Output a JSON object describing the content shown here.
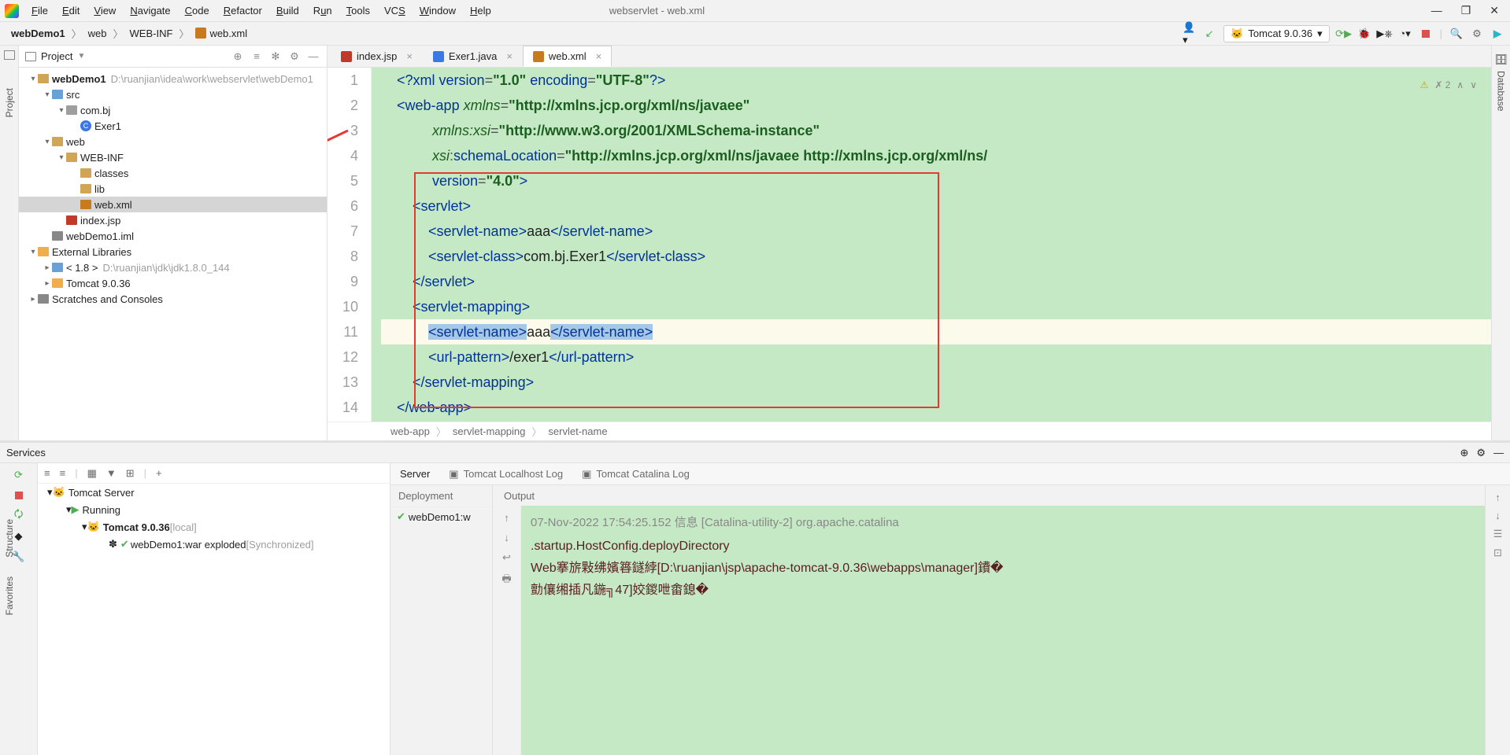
{
  "window": {
    "title": "webservlet - web.xml",
    "buttons": {
      "min": "—",
      "max": "❐",
      "close": "✕"
    }
  },
  "menu": [
    "File",
    "Edit",
    "View",
    "Navigate",
    "Code",
    "Refactor",
    "Build",
    "Run",
    "Tools",
    "VCS",
    "Window",
    "Help"
  ],
  "breadcrumbs": {
    "root": "webDemo1",
    "parts": [
      "web",
      "WEB-INF",
      "web.xml"
    ]
  },
  "runConfig": "Tomcat 9.0.36",
  "projectPanel": {
    "title": "Project",
    "tree": {
      "root": "webDemo1",
      "rootPath": "D:\\ruanjian\\idea\\work\\webservlet\\webDemo1",
      "src": "src",
      "pkg": "com.bj",
      "cls": "Exer1",
      "web": "web",
      "webinf": "WEB-INF",
      "classes": "classes",
      "lib": "lib",
      "webxml": "web.xml",
      "indexjsp": "index.jsp",
      "iml": "webDemo1.iml",
      "ext": "External Libraries",
      "jdk": "< 1.8 >",
      "jdkPath": "D:\\ruanjian\\jdk\\jdk1.8.0_144",
      "tomcat": "Tomcat 9.0.36",
      "scratches": "Scratches and Consoles"
    }
  },
  "leftTabs": {
    "project": "Project"
  },
  "rightTabs": {
    "database": "Database"
  },
  "bottomTabs": {
    "structure": "Structure",
    "favorites": "Favorites"
  },
  "editorTabs": [
    {
      "label": "index.jsp",
      "active": false,
      "color": "#c0392b"
    },
    {
      "label": "Exer1.java",
      "active": false,
      "color": "#3b78e7"
    },
    {
      "label": "web.xml",
      "active": true,
      "color": "#c77b1e"
    }
  ],
  "editorTopRight": "✗ 2",
  "codeLines": [
    {
      "n": 1,
      "seg": [
        {
          "t": "    ",
          "c": "pc"
        },
        {
          "t": "<?",
          "c": "tag"
        },
        {
          "t": "xml version",
          "c": "attr"
        },
        {
          "t": "=",
          "c": "pc"
        },
        {
          "t": "\"1.0\"",
          "c": "str"
        },
        {
          "t": " encoding",
          "c": "attr"
        },
        {
          "t": "=",
          "c": "pc"
        },
        {
          "t": "\"UTF-8\"",
          "c": "str"
        },
        {
          "t": "?>",
          "c": "tag"
        }
      ]
    },
    {
      "n": 2,
      "seg": [
        {
          "t": "    ",
          "c": "pc"
        },
        {
          "t": "<",
          "c": "tag"
        },
        {
          "t": "web-app ",
          "c": "tag"
        },
        {
          "t": "xmlns",
          "c": "attrn"
        },
        {
          "t": "=",
          "c": "pc"
        },
        {
          "t": "\"http://xmlns.jcp.org/xml/ns/javaee\"",
          "c": "str"
        }
      ]
    },
    {
      "n": 3,
      "seg": [
        {
          "t": "             ",
          "c": "pc"
        },
        {
          "t": "xmlns:xsi",
          "c": "attrn"
        },
        {
          "t": "=",
          "c": "pc"
        },
        {
          "t": "\"http://www.w3.org/2001/XMLSchema-instance\"",
          "c": "str"
        }
      ]
    },
    {
      "n": 4,
      "seg": [
        {
          "t": "             ",
          "c": "pc"
        },
        {
          "t": "xsi",
          "c": "attrn"
        },
        {
          "t": ":",
          "c": "pc"
        },
        {
          "t": "schemaLocation",
          "c": "attr"
        },
        {
          "t": "=",
          "c": "pc"
        },
        {
          "t": "\"http://xmlns.jcp.org/xml/ns/javaee http://xmlns.jcp.org/xml/ns/",
          "c": "str"
        }
      ]
    },
    {
      "n": 5,
      "seg": [
        {
          "t": "             ",
          "c": "pc"
        },
        {
          "t": "version",
          "c": "attr"
        },
        {
          "t": "=",
          "c": "pc"
        },
        {
          "t": "\"4.0\"",
          "c": "str"
        },
        {
          "t": ">",
          "c": "tag"
        }
      ]
    },
    {
      "n": 6,
      "seg": [
        {
          "t": "        ",
          "c": "pc"
        },
        {
          "t": "<",
          "c": "tag"
        },
        {
          "t": "servlet",
          "c": "tag"
        },
        {
          "t": ">",
          "c": "tag"
        }
      ]
    },
    {
      "n": 7,
      "seg": [
        {
          "t": "            ",
          "c": "pc"
        },
        {
          "t": "<",
          "c": "tag"
        },
        {
          "t": "servlet-name",
          "c": "tag"
        },
        {
          "t": ">",
          "c": "tag"
        },
        {
          "t": "aaa",
          "c": "txt"
        },
        {
          "t": "</",
          "c": "tag"
        },
        {
          "t": "servlet-name",
          "c": "tag"
        },
        {
          "t": ">",
          "c": "tag"
        }
      ]
    },
    {
      "n": 8,
      "seg": [
        {
          "t": "            ",
          "c": "pc"
        },
        {
          "t": "<",
          "c": "tag"
        },
        {
          "t": "servlet-class",
          "c": "tag"
        },
        {
          "t": ">",
          "c": "tag"
        },
        {
          "t": "com.bj.Exer1",
          "c": "txt"
        },
        {
          "t": "</",
          "c": "tag"
        },
        {
          "t": "servlet-class",
          "c": "tag"
        },
        {
          "t": ">",
          "c": "tag"
        }
      ]
    },
    {
      "n": 9,
      "seg": [
        {
          "t": "        ",
          "c": "pc"
        },
        {
          "t": "</",
          "c": "tag"
        },
        {
          "t": "servlet",
          "c": "tag"
        },
        {
          "t": ">",
          "c": "tag"
        }
      ]
    },
    {
      "n": 10,
      "seg": [
        {
          "t": "        ",
          "c": "pc"
        },
        {
          "t": "<",
          "c": "tag"
        },
        {
          "t": "servlet-mapping",
          "c": "tag"
        },
        {
          "t": ">",
          "c": "tag"
        }
      ]
    },
    {
      "n": 11,
      "hl": true,
      "seg": [
        {
          "t": "            ",
          "c": "pc"
        },
        {
          "t": "<",
          "c": "tag",
          "sel": true
        },
        {
          "t": "servlet-name",
          "c": "tag",
          "sel": true
        },
        {
          "t": ">",
          "c": "tag",
          "sel": true
        },
        {
          "t": "aaa",
          "c": "txt"
        },
        {
          "t": "</",
          "c": "tag",
          "sel": true
        },
        {
          "t": "servlet-na",
          "c": "tag",
          "sel": true
        },
        {
          "t": "me",
          "c": "tag",
          "sel": true
        },
        {
          "t": ">",
          "c": "tag",
          "sel": true
        }
      ]
    },
    {
      "n": 12,
      "seg": [
        {
          "t": "            ",
          "c": "pc"
        },
        {
          "t": "<",
          "c": "tag"
        },
        {
          "t": "url-pattern",
          "c": "tag"
        },
        {
          "t": ">",
          "c": "tag"
        },
        {
          "t": "/exer1",
          "c": "txt"
        },
        {
          "t": "</",
          "c": "tag"
        },
        {
          "t": "url-pattern",
          "c": "tag"
        },
        {
          "t": ">",
          "c": "tag"
        }
      ]
    },
    {
      "n": 13,
      "seg": [
        {
          "t": "        ",
          "c": "pc"
        },
        {
          "t": "</",
          "c": "tag"
        },
        {
          "t": "servlet-mapping",
          "c": "tag"
        },
        {
          "t": ">",
          "c": "tag"
        }
      ]
    },
    {
      "n": 14,
      "seg": [
        {
          "t": "    ",
          "c": "pc"
        },
        {
          "t": "</",
          "c": "tag"
        },
        {
          "t": "web-app",
          "c": "tag"
        },
        {
          "t": ">",
          "c": "tag"
        }
      ]
    }
  ],
  "editorBreadcrumb": [
    "web-app",
    "servlet-mapping",
    "servlet-name"
  ],
  "services": {
    "title": "Services",
    "tree": {
      "root": "Tomcat Server",
      "running": "Running",
      "server": "Tomcat 9.0.36",
      "serverSuffix": "[local]",
      "artifact": "webDemo1:war exploded",
      "artifactSuffix": "[Synchronized]"
    },
    "tabs": [
      "Server",
      "Tomcat Localhost Log",
      "Tomcat Catalina Log"
    ],
    "deployHdr": "Deployment",
    "deployItem": "webDemo1:w",
    "outputHdr": "Output",
    "consoleLines": [
      ".startup.HostConfig.deployDirectory",
      "Web搴旂敤绋嬪簭鐩綍[D:\\ruanjian\\jsp\\apache-tomcat-9.0.36\\webapps\\manager]鐨�",
      "勯儴缃插凡鍦╗47]姣鍐呭畬鎴�"
    ]
  }
}
